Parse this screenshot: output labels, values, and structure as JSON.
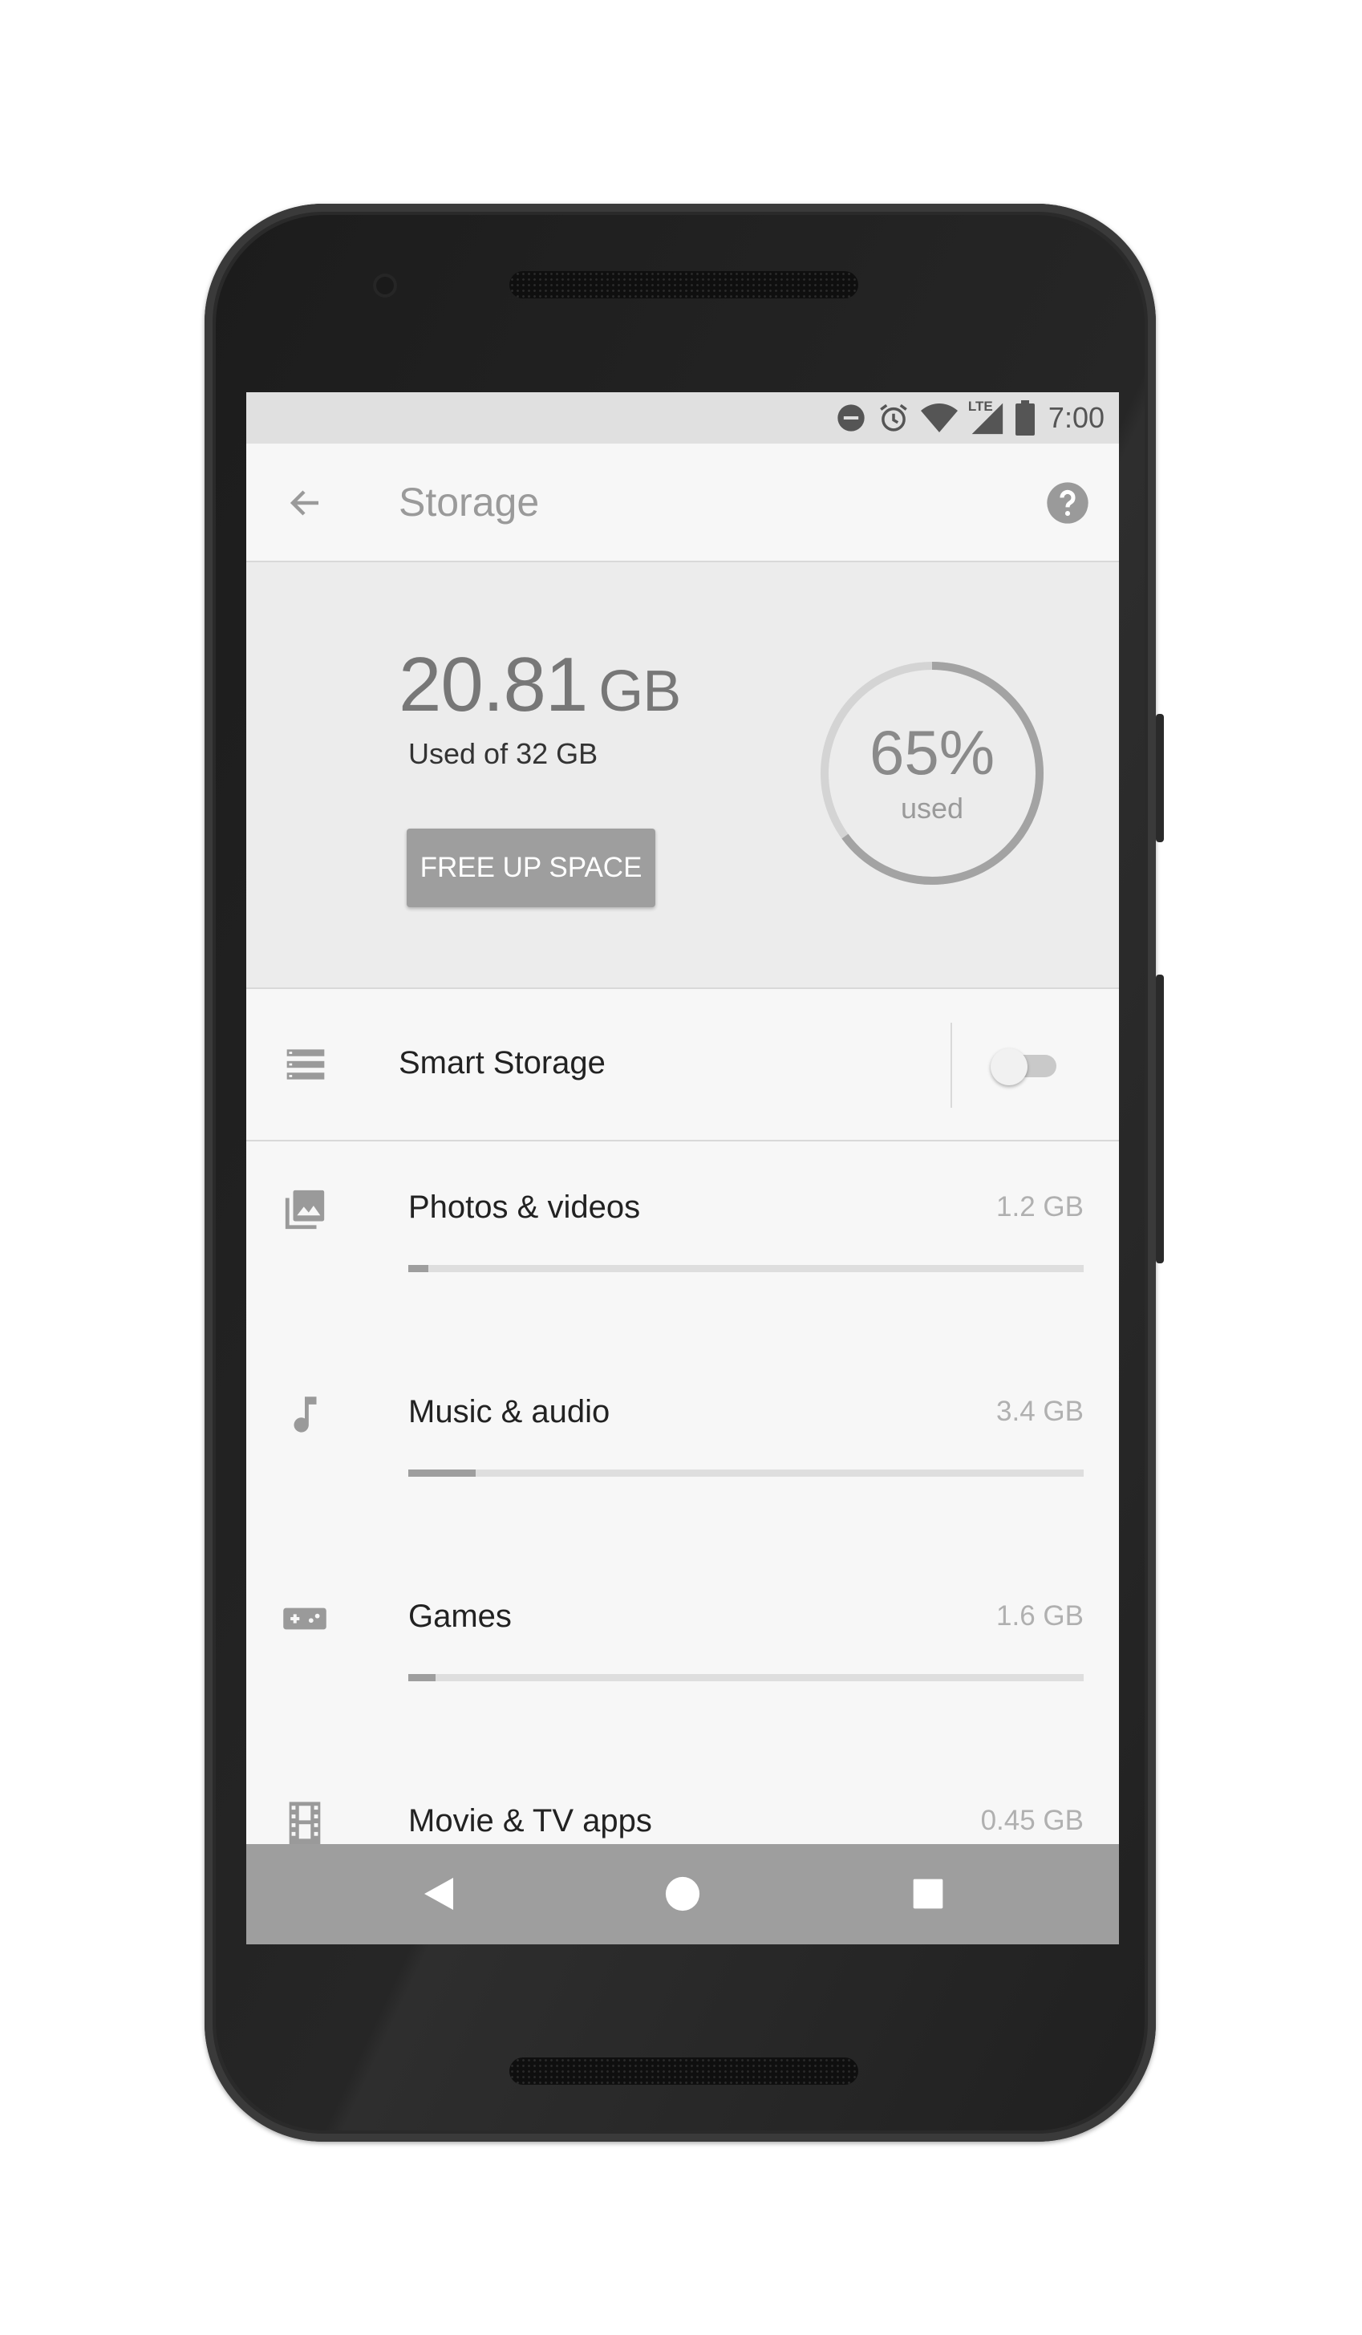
{
  "status_bar": {
    "time": "7:00",
    "icons": [
      "do-not-disturb-icon",
      "alarm-icon",
      "wifi-icon",
      "lte-signal-icon",
      "battery-icon"
    ],
    "network_label": "LTE"
  },
  "toolbar": {
    "title": "Storage",
    "back_icon": "arrow-left-icon",
    "help_icon": "help-circle-icon"
  },
  "summary": {
    "used_value": "20.81",
    "used_unit": "GB",
    "used_of": "Used of 32 GB",
    "free_up_button": "FREE UP SPACE",
    "percent_label": "65%",
    "percent_sub": "used",
    "percent_fraction": 0.65
  },
  "smart_storage": {
    "label": "Smart Storage",
    "enabled": false
  },
  "categories": [
    {
      "label": "Photos & videos",
      "size": "1.2 GB",
      "fraction": 0.03,
      "icon": "photo-library-icon"
    },
    {
      "label": "Music & audio",
      "size": "3.4 GB",
      "fraction": 0.1,
      "icon": "music-note-icon"
    },
    {
      "label": "Games",
      "size": "1.6 GB",
      "fraction": 0.04,
      "icon": "gamepad-icon"
    },
    {
      "label": "Movie & TV apps",
      "size": "0.45 GB",
      "fraction": 0.01,
      "icon": "film-icon"
    }
  ],
  "colors": {
    "status_bar": "#e0e0e0",
    "summary_background": "#ececec",
    "accent_gray": "#9e9e9e",
    "nav_bar": "#9e9e9e"
  }
}
